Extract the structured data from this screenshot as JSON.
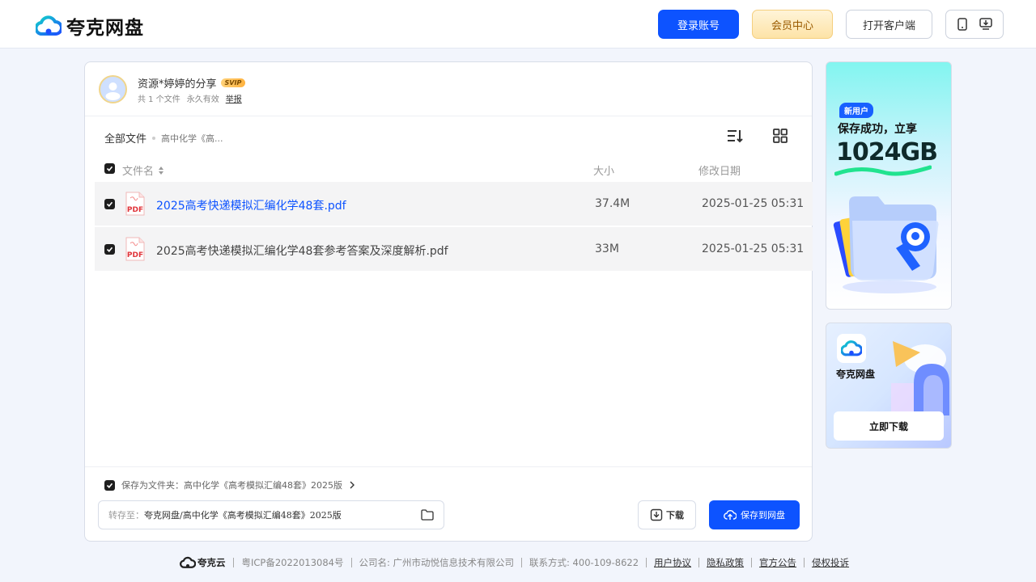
{
  "header": {
    "logo_text": "夸克网盘",
    "login_label": "登录账号",
    "vip_label": "会员中心",
    "client_label": "打开客户端"
  },
  "share": {
    "title": "资源*婷婷的分享",
    "badge": "SVIP",
    "file_count": "共 1 个文件",
    "validity": "永久有效",
    "report": "举报"
  },
  "breadcrumb": {
    "root": "全部文件",
    "current": "高中化学《高..."
  },
  "table": {
    "col_name": "文件名",
    "col_size": "大小",
    "col_date": "修改日期",
    "rows": [
      {
        "name": "2025高考快递模拟汇编化学48套.pdf",
        "size": "37.4M",
        "date": "2025-01-25 05:31",
        "type_label": "PDF"
      },
      {
        "name": "2025高考快递模拟汇编化学48套参考答案及深度解析.pdf",
        "size": "33M",
        "date": "2025-01-25 05:31",
        "type_label": "PDF"
      }
    ]
  },
  "save": {
    "folder_label": "保存为文件夹：高中化学《高考模拟汇编48套》2025版",
    "to_label": "转存至：",
    "to_path": "夸克网盘/高中化学《高考模拟汇编48套》2025版",
    "download_label": "下载",
    "save_label": "保存到网盘"
  },
  "ads": {
    "ad1_badge": "新用户",
    "ad1_line1": "保存成功，立享",
    "ad1_line2": "1024GB",
    "ad2_name": "夸克网盘",
    "ad2_button": "立即下载"
  },
  "footer": {
    "logo": "夸克云",
    "icp": "粤ICP备2022013084号",
    "company": "公司名: 广州市动悦信息技术有限公司",
    "contact": "联系方式: 400-109-8622",
    "links": [
      "用户协议",
      "隐私政策",
      "官方公告",
      "侵权投诉"
    ]
  },
  "colors": {
    "brand_blue": "#0d53ff",
    "page_bg": "#f2f5fc",
    "vip_gold": "#fde3a7"
  }
}
